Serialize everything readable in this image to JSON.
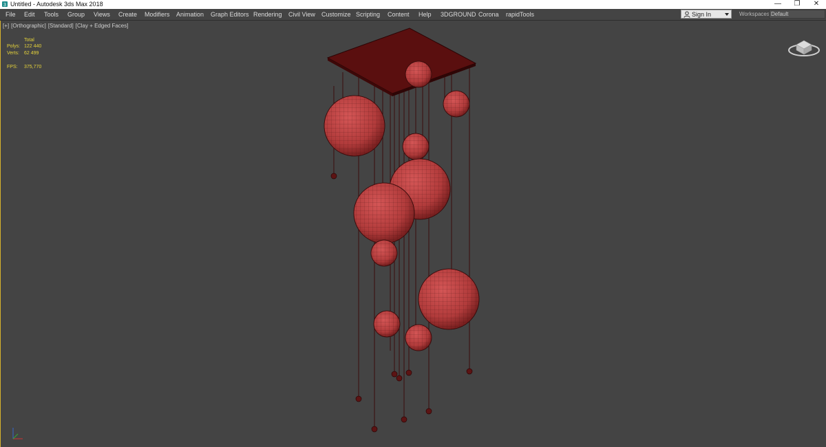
{
  "window": {
    "title": "Untitled - Autodesk 3ds Max 2018",
    "controls": {
      "minimize": "—",
      "restore": "❐",
      "close": "✕"
    }
  },
  "menu": [
    "File",
    "Edit",
    "Tools",
    "Group",
    "Views",
    "Create",
    "Modifiers",
    "Animation",
    "Graph Editors",
    "Rendering",
    "Civil View",
    "Customize",
    "Scripting",
    "Content",
    "Help",
    "3DGROUND",
    "Corona",
    "rapidTools"
  ],
  "account": {
    "signin_label": "Sign In",
    "workspaces_label": "Workspaces:",
    "workspace_value": "Default"
  },
  "viewport": {
    "labels": [
      "[+]",
      "[Orthographic]",
      "[Standard]",
      "[Clay + Edged Faces]"
    ],
    "stats": {
      "total_label": "Total",
      "polys_label": "Polys:",
      "polys_value": "122 440",
      "verts_label": "Verts:",
      "verts_value": "62 499",
      "fps_label": "FPS:",
      "fps_value": "375,770"
    },
    "viewcube_label": "",
    "colors": {
      "model": "#b13b3b",
      "background": "#444444",
      "wire": "#3a0c0c",
      "stats_text": "#e6d33a"
    }
  }
}
